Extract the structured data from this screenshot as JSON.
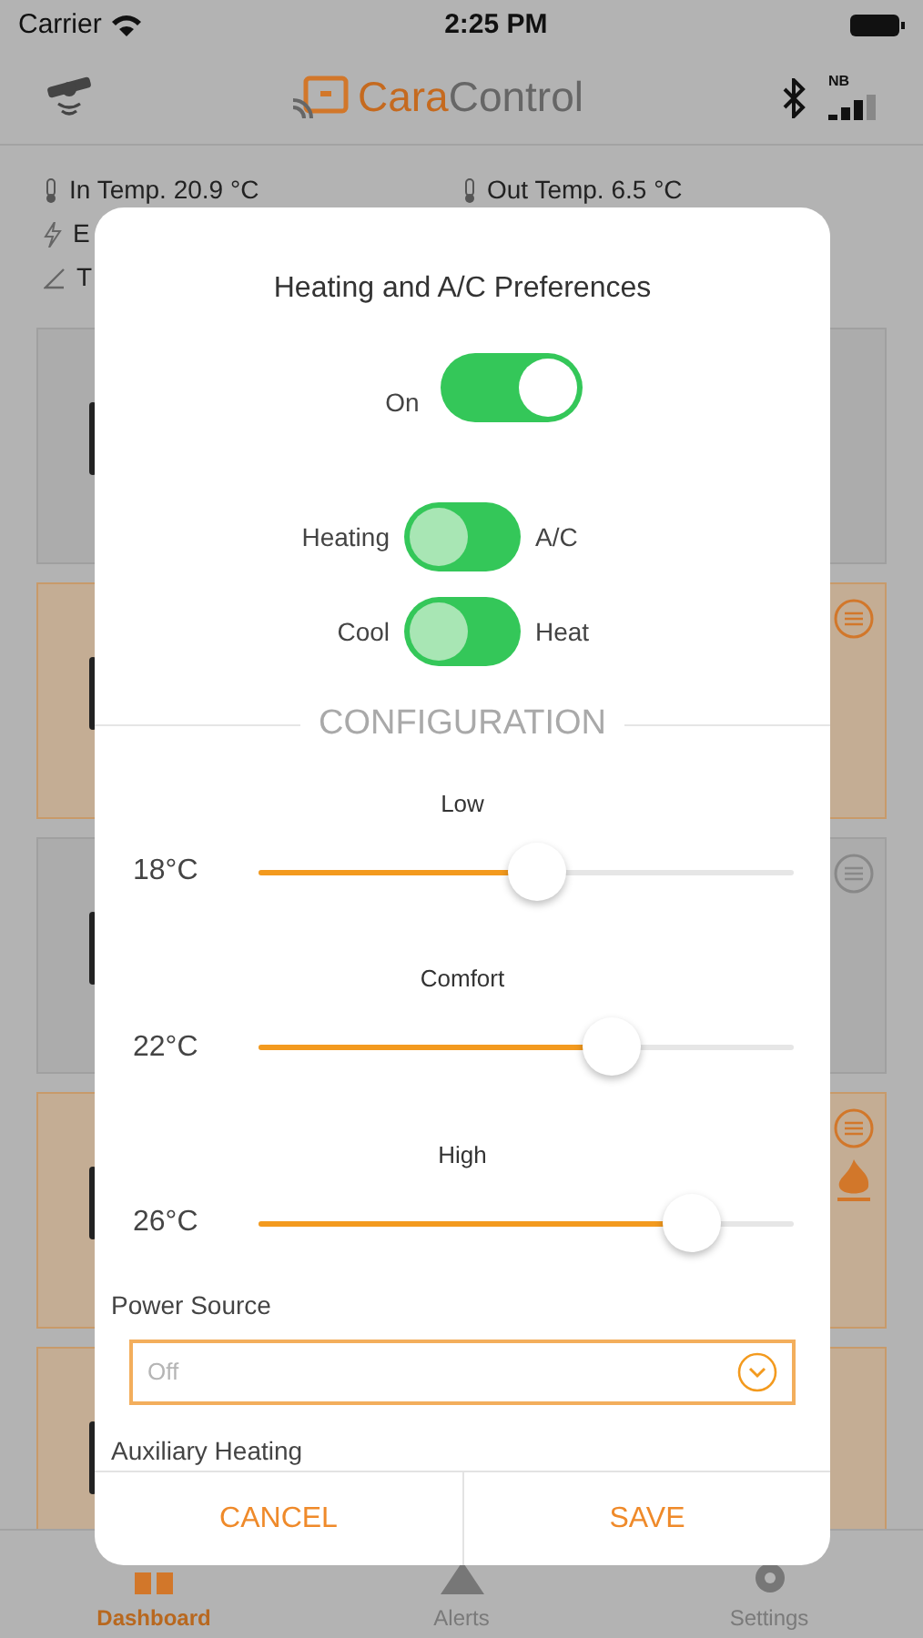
{
  "status_bar": {
    "carrier": "Carrier",
    "time": "2:25 PM"
  },
  "header": {
    "brand_accent": "Cara",
    "brand_rest": "Control",
    "network_label": "NB"
  },
  "readings": [
    [
      {
        "text": "In Temp. 20.9 °C",
        "kind": "temp"
      },
      {
        "text": "Out Temp. 6.5 °C",
        "kind": "temp"
      }
    ],
    [
      {
        "text": "E",
        "kind": "power"
      }
    ],
    [
      {
        "text": "T",
        "kind": "tilt"
      }
    ]
  ],
  "cards": [
    {
      "highlighted": false
    },
    {
      "highlighted": true,
      "icons": [
        {
          "kind": "sliders"
        }
      ]
    },
    {
      "highlighted": false,
      "icons": [
        {
          "kind": "sliders"
        }
      ]
    },
    {
      "highlighted": true,
      "icons": [
        {
          "kind": "sliders"
        },
        {
          "kind": "flame"
        }
      ]
    },
    {
      "highlighted": true
    }
  ],
  "dialog": {
    "title": "Heating and A/C Preferences",
    "power_switch": {
      "label": "On",
      "on": true
    },
    "mode_switches": [
      {
        "left_label": "Heating",
        "right_label": "A/C",
        "on": false
      },
      {
        "left_label": "Cool",
        "right_label": "Heat",
        "on": false
      }
    ],
    "section_title": "CONFIGURATION",
    "sliders": [
      {
        "label": "Low",
        "reading": "18°C",
        "level": 0.52
      },
      {
        "label": "Comfort",
        "reading": "22°C",
        "level": 0.66
      },
      {
        "label": "High",
        "reading": "26°C",
        "level": 0.81
      }
    ],
    "power_source": {
      "label": "Power Source",
      "value": "Off"
    },
    "auxiliary_label": "Auxiliary Heating",
    "buttons": [
      "CANCEL",
      "SAVE"
    ]
  },
  "tab_bar": [
    {
      "label": "Dashboard",
      "kind": "dashboard",
      "selected": true
    },
    {
      "label": "Alerts",
      "kind": "alerts",
      "selected": false
    },
    {
      "label": "Settings",
      "kind": "settings",
      "selected": false
    }
  ]
}
